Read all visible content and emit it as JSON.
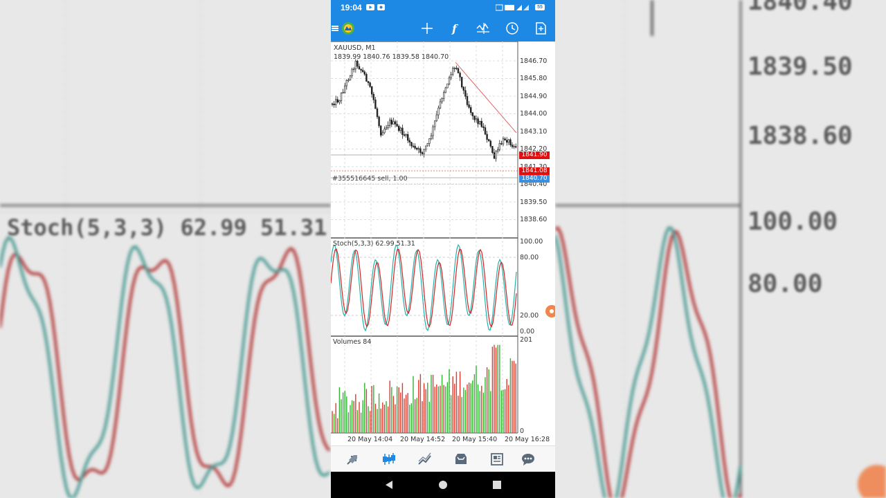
{
  "status_bar": {
    "time": "19:04",
    "battery": "55"
  },
  "chart": {
    "symbol_label": "XAUUSD, M1",
    "ohlc_label": "1839.99 1840.76 1839.58 1840.70",
    "price_axis": [
      "1846.70",
      "1845.80",
      "1844.90",
      "1844.00",
      "1843.10",
      "1842.20",
      "1841.30",
      "1840.40",
      "1839.50",
      "1838.60"
    ],
    "price_tags": {
      "bid": "1841.90",
      "sell_level": "1841.08",
      "current": "1840.70"
    },
    "order_label": "#355516645 sell, 1.00",
    "stoch_label": "Stoch(5,3,3) 62.99 51.31",
    "stoch_axis": [
      "100.00",
      "80.00",
      "20.00",
      "0.00"
    ],
    "volumes_label": "Volumes 84",
    "volume_axis": {
      "max": "201",
      "min": "0"
    },
    "time_axis": [
      "20 May 14:04",
      "20 May 14:52",
      "20 May 15:40",
      "20 May 16:28"
    ],
    "colors": {
      "bull": "#2db52d",
      "bear": "#e0392b",
      "stoch_main": "#20b2aa",
      "stoch_signal": "#d62020",
      "app_bar": "#1e88e5",
      "sell_tag": "#e01010",
      "current_tag": "#3b8fe0"
    }
  },
  "background": {
    "right_labels": [
      "1840.40",
      "1839.50",
      "1838.60",
      "100.00",
      "80.00"
    ],
    "left_label": "Stoch(5,3,3) 62.99 51.31"
  },
  "app_bar_icons": [
    "menu-icon",
    "account-icon",
    "crosshair-icon",
    "function-icon",
    "objects-icon",
    "timeframe-icon",
    "new-order-icon"
  ],
  "bottom_nav_icons": [
    "quotes-icon",
    "chart-icon",
    "trade-icon",
    "history-icon",
    "news-icon",
    "chat-icon"
  ]
}
